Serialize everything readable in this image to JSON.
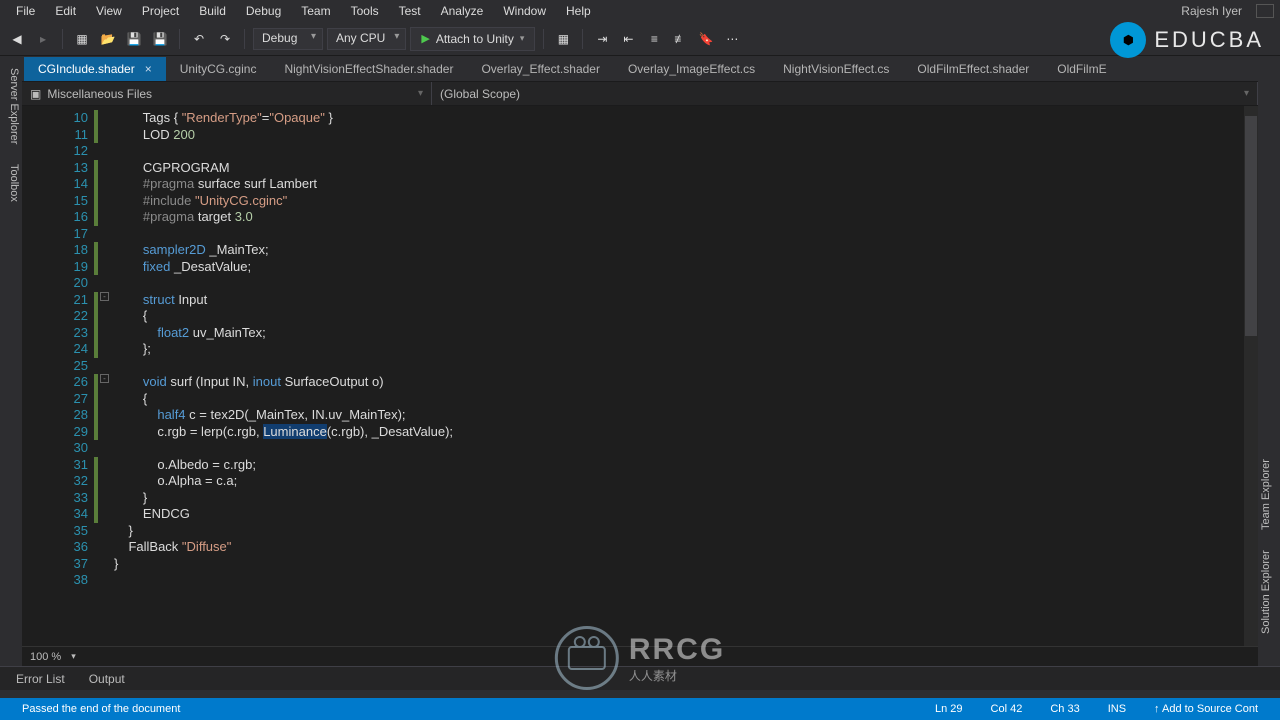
{
  "menu": {
    "items": [
      "File",
      "Edit",
      "View",
      "Project",
      "Build",
      "Debug",
      "Team",
      "Tools",
      "Test",
      "Analyze",
      "Window",
      "Help"
    ],
    "user": "Rajesh Iyer"
  },
  "toolbar": {
    "config": "Debug",
    "platform": "Any CPU",
    "attach": "Attach to Unity"
  },
  "brand": {
    "name": "EDUCBA"
  },
  "tabs": [
    {
      "label": "CGInclude.shader",
      "active": true
    },
    {
      "label": "UnityCG.cginc"
    },
    {
      "label": "NightVisionEffectShader.shader"
    },
    {
      "label": "Overlay_Effect.shader"
    },
    {
      "label": "Overlay_ImageEffect.cs"
    },
    {
      "label": "NightVisionEffect.cs"
    },
    {
      "label": "OldFilmEffect.shader"
    },
    {
      "label": "OldFilmE"
    }
  ],
  "nav": {
    "left": "Miscellaneous Files",
    "right": "(Global Scope)"
  },
  "rails": {
    "left": [
      "Server Explorer",
      "Toolbox"
    ],
    "right": [
      "Solution Explorer",
      "Team Explorer"
    ]
  },
  "code": {
    "first_line": 10,
    "lines": [
      {
        "n": 10,
        "tokens": [
          [
            "        Tags { ",
            ""
          ],
          [
            "\"RenderType\"",
            "str"
          ],
          [
            "=",
            ""
          ],
          [
            "\"Opaque\"",
            "str"
          ],
          [
            " }",
            ""
          ]
        ]
      },
      {
        "n": 11,
        "tokens": [
          [
            "        LOD ",
            ""
          ],
          [
            "200",
            "num"
          ]
        ]
      },
      {
        "n": 12,
        "tokens": [
          [
            "",
            ""
          ]
        ]
      },
      {
        "n": 13,
        "tokens": [
          [
            "        CGPROGRAM",
            ""
          ]
        ]
      },
      {
        "n": 14,
        "tokens": [
          [
            "        ",
            ""
          ],
          [
            "#pragma",
            "pragma"
          ],
          [
            " surface surf Lambert",
            ""
          ]
        ]
      },
      {
        "n": 15,
        "tokens": [
          [
            "        ",
            ""
          ],
          [
            "#include",
            "pragma"
          ],
          [
            " ",
            ""
          ],
          [
            "\"UnityCG.cginc\"",
            "str"
          ]
        ]
      },
      {
        "n": 16,
        "tokens": [
          [
            "        ",
            ""
          ],
          [
            "#pragma",
            "pragma"
          ],
          [
            " target ",
            ""
          ],
          [
            "3.0",
            "num"
          ]
        ]
      },
      {
        "n": 17,
        "tokens": [
          [
            "",
            ""
          ]
        ]
      },
      {
        "n": 18,
        "tokens": [
          [
            "        ",
            ""
          ],
          [
            "sampler2D",
            "kw"
          ],
          [
            " _MainTex;",
            ""
          ]
        ]
      },
      {
        "n": 19,
        "tokens": [
          [
            "        ",
            ""
          ],
          [
            "fixed",
            "kw"
          ],
          [
            " _DesatValue;",
            ""
          ]
        ]
      },
      {
        "n": 20,
        "tokens": [
          [
            "",
            ""
          ]
        ]
      },
      {
        "n": 21,
        "tokens": [
          [
            "        ",
            ""
          ],
          [
            "struct",
            "kw"
          ],
          [
            " Input",
            ""
          ]
        ]
      },
      {
        "n": 22,
        "tokens": [
          [
            "        {",
            ""
          ]
        ]
      },
      {
        "n": 23,
        "tokens": [
          [
            "            ",
            ""
          ],
          [
            "float2",
            "kw"
          ],
          [
            " uv_MainTex;",
            ""
          ]
        ]
      },
      {
        "n": 24,
        "tokens": [
          [
            "        };",
            ""
          ]
        ]
      },
      {
        "n": 25,
        "tokens": [
          [
            "",
            ""
          ]
        ]
      },
      {
        "n": 26,
        "tokens": [
          [
            "        ",
            ""
          ],
          [
            "void",
            "kw"
          ],
          [
            " surf (Input IN, ",
            ""
          ],
          [
            "inout",
            "kw"
          ],
          [
            " SurfaceOutput o)",
            ""
          ]
        ]
      },
      {
        "n": 27,
        "tokens": [
          [
            "        {",
            ""
          ]
        ]
      },
      {
        "n": 28,
        "tokens": [
          [
            "            ",
            ""
          ],
          [
            "half4",
            "kw"
          ],
          [
            " c = tex2D(_MainTex, IN.uv_MainTex);",
            ""
          ]
        ]
      },
      {
        "n": 29,
        "tokens": [
          [
            "            c.rgb = lerp(c.rgb, ",
            ""
          ],
          [
            "Luminance",
            "hl"
          ],
          [
            "(c.rgb), _DesatValue);",
            ""
          ]
        ]
      },
      {
        "n": 30,
        "tokens": [
          [
            "",
            ""
          ]
        ]
      },
      {
        "n": 31,
        "tokens": [
          [
            "            o.Albedo = c.rgb;",
            ""
          ]
        ]
      },
      {
        "n": 32,
        "tokens": [
          [
            "            o.Alpha = c.a;",
            ""
          ]
        ]
      },
      {
        "n": 33,
        "tokens": [
          [
            "        }",
            ""
          ]
        ]
      },
      {
        "n": 34,
        "tokens": [
          [
            "        ENDCG",
            ""
          ]
        ]
      },
      {
        "n": 35,
        "tokens": [
          [
            "    }",
            ""
          ]
        ]
      },
      {
        "n": 36,
        "tokens": [
          [
            "    FallBack ",
            ""
          ],
          [
            "\"Diffuse\"",
            "str"
          ]
        ]
      },
      {
        "n": 37,
        "tokens": [
          [
            "}",
            ""
          ]
        ]
      },
      {
        "n": 38,
        "tokens": [
          [
            "",
            ""
          ]
        ]
      }
    ],
    "folds": [
      {
        "line": 21,
        "glyph": "-"
      },
      {
        "line": 26,
        "glyph": "-"
      }
    ],
    "change_segments": [
      [
        10,
        11
      ],
      [
        13,
        16
      ],
      [
        18,
        19
      ],
      [
        21,
        24
      ],
      [
        26,
        29
      ],
      [
        31,
        34
      ]
    ]
  },
  "zoom": "100 %",
  "bottom_tabs": [
    "Error List",
    "Output"
  ],
  "status": {
    "msg": "Passed the end of the document",
    "ln": "Ln 29",
    "col": "Col 42",
    "ch": "Ch 33",
    "ins": "INS",
    "add": "↑ Add to Source Cont"
  },
  "watermark": {
    "title": "RRCG",
    "sub": "人人素材"
  }
}
